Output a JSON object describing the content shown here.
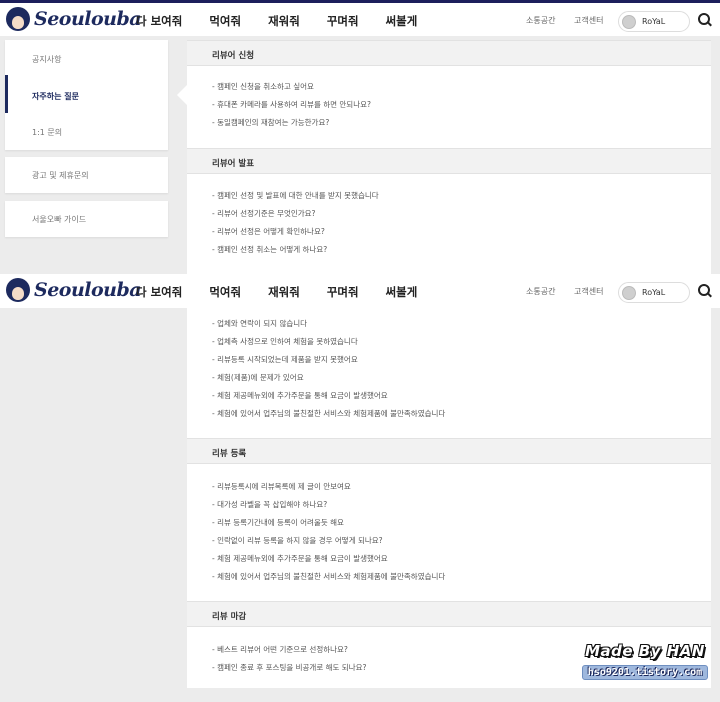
{
  "header": {
    "logo_text": "Seoulouba",
    "nav": [
      "다 보여줘",
      "먹여줘",
      "재워줘",
      "꾸며줘",
      "써볼게"
    ],
    "community": "소통공간",
    "support": "고객센터",
    "username": "RoYaL"
  },
  "sidebar": {
    "group1": [
      "공지사항",
      "자주하는 질문",
      "1:1 문의"
    ],
    "ad_inquiry": "광고 및 제휴문의",
    "guide": "서울오빠 가이드"
  },
  "sections": {
    "apply": {
      "title": "리뷰어 신청",
      "items": [
        "- 캠페인 신청을 취소하고 싶어요",
        "- 휴대폰 카메라를 사용하여 리뷰를 하면 안되나요?",
        "- 동일캠페인의 재참여는 가능한가요?"
      ]
    },
    "announce": {
      "title": "리뷰어 발표",
      "items": [
        "- 캠페인 선정 및 발표에 대한 안내를 받지 못했습니다",
        "- 리뷰어 선정기준은 무엇인가요?",
        "- 리뷰어 선정은 어떻게 확인하나요?",
        "- 캠페인 선정 취소는 어떻게 하나요?"
      ]
    },
    "continued": {
      "items": [
        "- 업체와 연락이 되지 않습니다",
        "- 업체측 사정으로 인하여 체험을 못하였습니다",
        "- 리뷰등록 시작되었는데 제품을 받지 못했어요",
        "- 체험(제품)에 문제가 있어요",
        "- 체험 제공메뉴외에 추가주문을 통해 요금이 발생했어요",
        "- 체험에 있어서 업주님의 불친절한 서비스와 체험제품에 불만족하였습니다"
      ]
    },
    "register": {
      "title": "리뷰 등록",
      "items": [
        "- 리뷰등록시에 리뷰목록에 제 글이 안보여요",
        "- 대가성 라벨을 꼭 삽입해야 하나요?",
        "- 리뷰 등록기간내에 등록이 어려울듯 해요",
        "- 인락없이 리뷰 등록을 하지 않을 경우 어떻게 되나요?",
        "- 체험 제공메뉴외에 추가주문을 통해 요금이 발생했어요",
        "- 체험에 있어서 업주님의 불친절한 서비스와 체험제품에 불만족하였습니다"
      ]
    },
    "deadline": {
      "title": "리뷰 마감",
      "items": [
        "- 베스트 리뷰어 어떤 기준으로 선정하나요?",
        "- 캠페인 종료 후 포스팅을 비공개로 해도 되나요?"
      ]
    }
  },
  "watermark": {
    "title": "Made By HAN",
    "url": "hso9201.tistory.com"
  },
  "colors": {
    "brand": "#1d2a5e",
    "page_bg": "#ececec",
    "section_header_bg": "#f2f2f2"
  }
}
